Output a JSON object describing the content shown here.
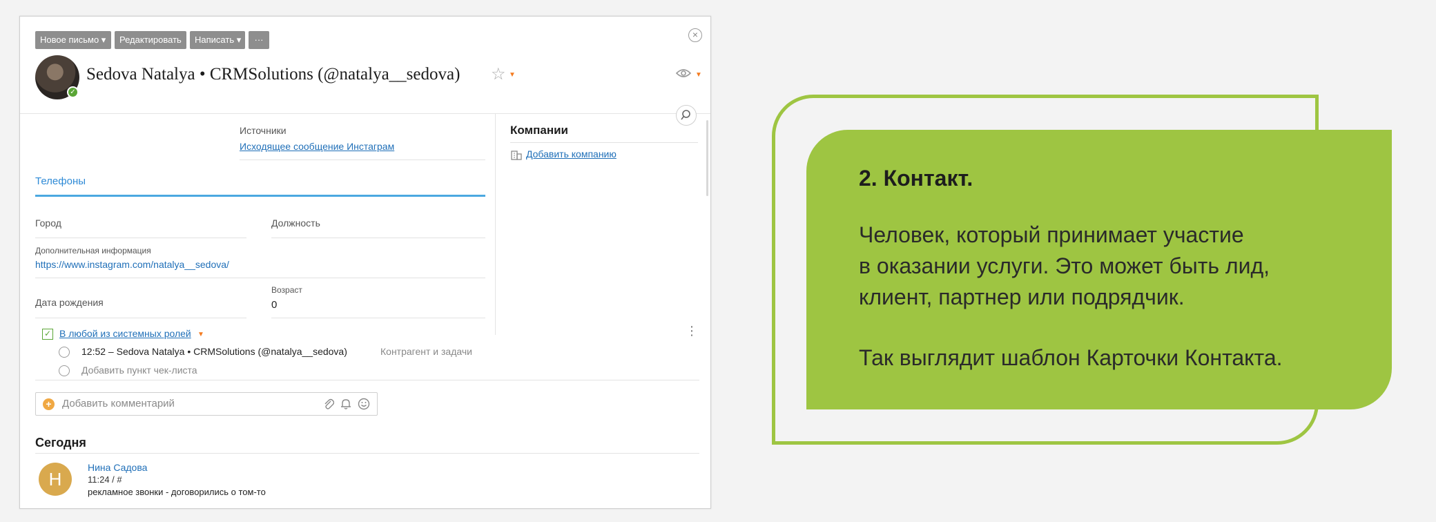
{
  "toolbar": {
    "new_letter": "Новое письмо ▾",
    "edit": "Редактировать",
    "write": "Написать ▾",
    "more": "···"
  },
  "contact": {
    "title": "Sedova Natalya • CRMSolutions (@natalya__sedova)"
  },
  "fields": {
    "sources_label": "Источники",
    "sources_value": "Исходящее сообщение Инстаграм",
    "phones_tab": "Телефоны",
    "city_label": "Город",
    "position_label": "Должность",
    "extra_info_label": "Дополнительная информация",
    "extra_info_value": "https://www.instagram.com/natalya__sedova/",
    "birthday_label": "Дата рождения",
    "age_label": "Возраст",
    "age_value": "0"
  },
  "companies": {
    "heading": "Компании",
    "add_link": "Добавить компанию"
  },
  "checklist": {
    "role_link": "В любой из системных ролей",
    "task_text": "12:52 – Sedova Natalya • CRMSolutions (@natalya__sedova)",
    "task_tag": "Контрагент и задачи",
    "add_item": "Добавить пункт чек-листа"
  },
  "comment": {
    "placeholder": "Добавить комментарий"
  },
  "feed": {
    "section": "Сегодня",
    "avatar_letter": "Н",
    "author": "Нина Садова",
    "time": "11:24 / #",
    "text": "рекламное звонки - договорились о том-то"
  },
  "info_panel": {
    "title": "2. Контакт.",
    "line1": "Человек, который принимает участие",
    "line2": "в оказании услуги. Это может быть лид,",
    "line3": "клиент, партнер или подрядчик.",
    "line4": "Так выглядит шаблон Карточки Контакта."
  },
  "colors": {
    "accent_green": "#9ec542",
    "link_blue": "#1f6fb8",
    "tab_blue": "#4ba8e0",
    "orange": "#f47b20",
    "avatar_gold": "#d9a94e"
  }
}
